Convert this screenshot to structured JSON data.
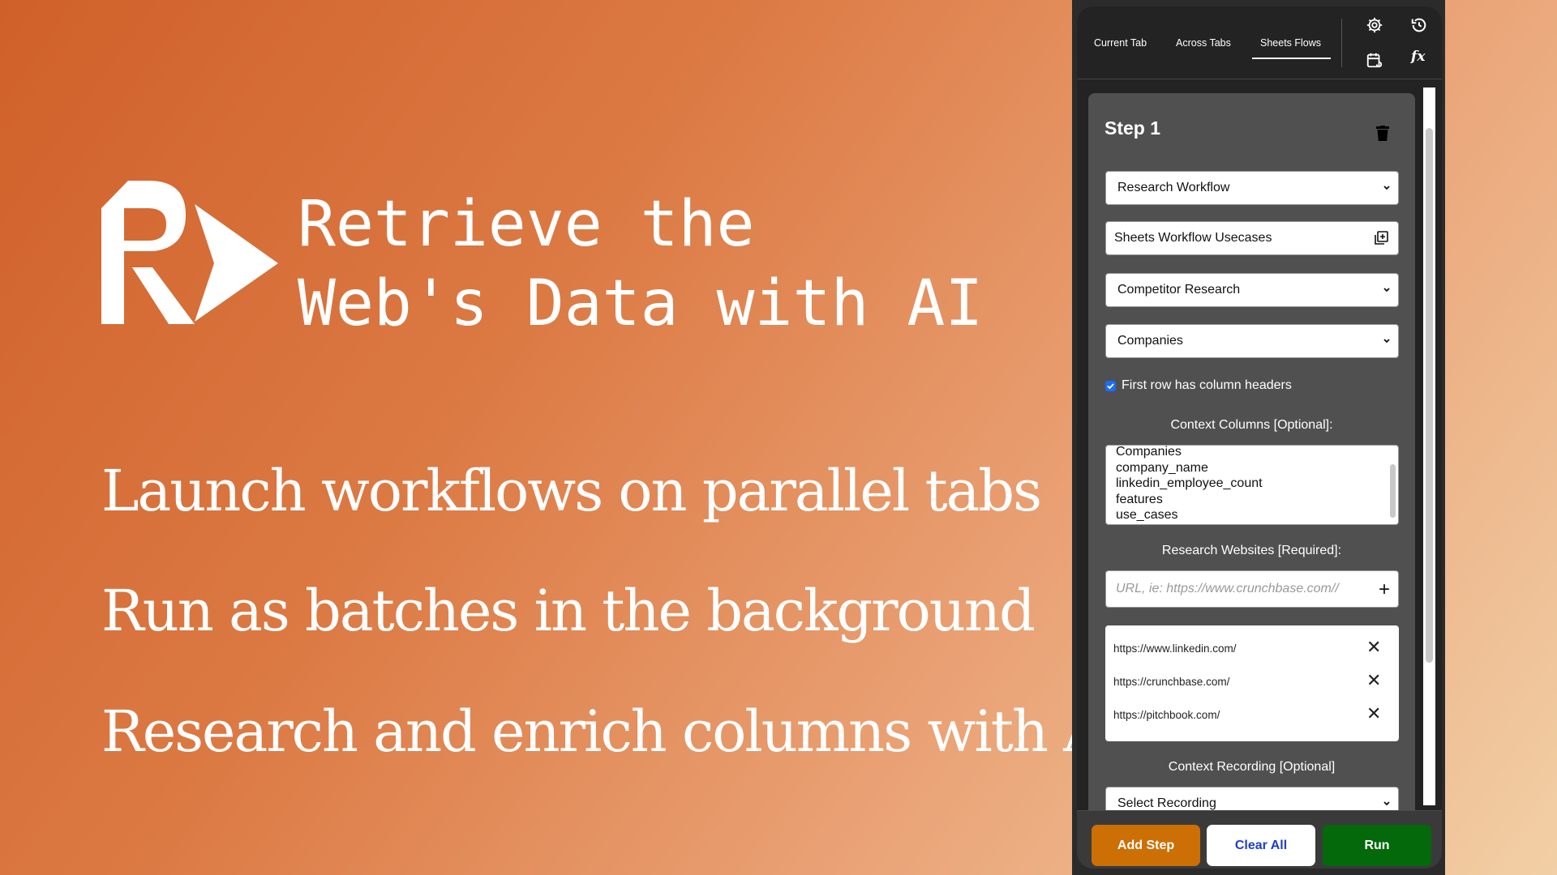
{
  "headline": [
    "Retrieve the",
    "Web's Data with AI"
  ],
  "features": [
    "Launch workflows on parallel tabs",
    "Run as batches in the background",
    "Research and enrich columns with AI"
  ],
  "panel": {
    "tabs": [
      {
        "label": "Current Tab",
        "active": false
      },
      {
        "label": "Across Tabs",
        "active": false
      },
      {
        "label": "Sheets Flows",
        "active": true
      }
    ],
    "icons": [
      "gear-icon",
      "history-icon",
      "calendar-refresh-icon",
      "function-icon"
    ],
    "step": {
      "title": "Step 1",
      "workflow_select": "Research Workflow",
      "sheet_field": "Sheets Workflow Usecases",
      "tab_select": "Competitor Research",
      "sheet_select": "Companies",
      "first_row_headers": {
        "label": "First row has column headers",
        "checked": true
      },
      "context_columns_label": "Context Columns [Optional]:",
      "context_columns": [
        "Companies",
        "company_name",
        "linkedin_employee_count",
        "features",
        "use_cases"
      ],
      "research_websites_label": "Research Websites [Required]:",
      "url_placeholder": "URL, ie: https://www.crunchbase.com//",
      "urls": [
        "https://www.linkedin.com/",
        "https://crunchbase.com/",
        "https://pitchbook.com/"
      ],
      "context_recording_label": "Context Recording [Optional]",
      "recording_select": "Select Recording"
    },
    "footer": {
      "add_step": "Add Step",
      "clear_all": "Clear All",
      "run": "Run"
    },
    "colors": {
      "add_step": "#cc6f05",
      "clear_all_text": "#1f3fc4",
      "run": "#04690a",
      "checkbox": "#1a6ef5"
    }
  }
}
